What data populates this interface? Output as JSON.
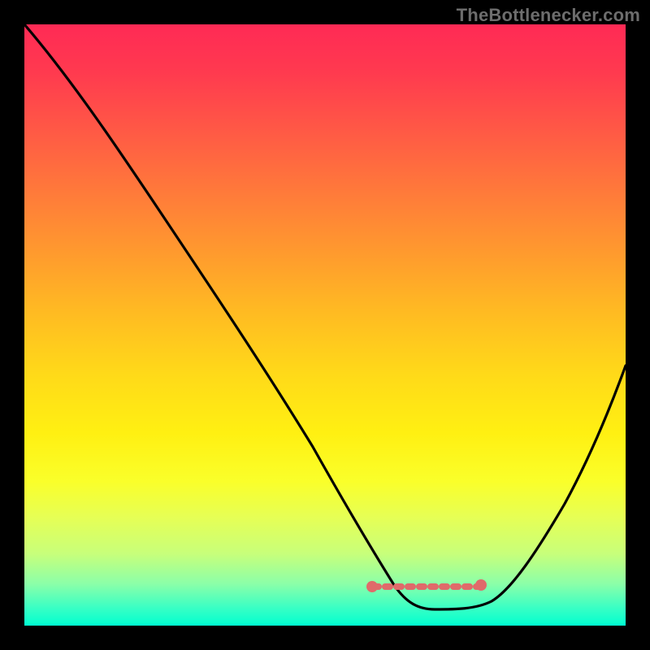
{
  "watermark": "TheBottleneсker.com",
  "chart_data": {
    "type": "line",
    "title": "",
    "xlabel": "",
    "ylabel": "",
    "xlim": [
      0,
      100
    ],
    "ylim": [
      0,
      100
    ],
    "series": [
      {
        "name": "bottleneck-curve",
        "x": [
          0,
          6,
          12,
          18,
          24,
          30,
          36,
          42,
          48,
          54,
          58,
          62,
          66,
          70,
          74,
          78,
          82,
          86,
          90,
          94,
          98,
          100
        ],
        "values": [
          100,
          91,
          82,
          73,
          64,
          55,
          46,
          37,
          28,
          19,
          13,
          8,
          5,
          3,
          3,
          4,
          8,
          15,
          24,
          34,
          44,
          49
        ]
      }
    ],
    "annotations": [
      {
        "name": "optimal-range-marker",
        "x_start": 58,
        "x_end": 76,
        "y": 6
      }
    ],
    "background_gradient": {
      "stops": [
        {
          "pos": 0.0,
          "color": "#ff2a55"
        },
        {
          "pos": 0.5,
          "color": "#ffd919"
        },
        {
          "pos": 0.8,
          "color": "#faff2a"
        },
        {
          "pos": 1.0,
          "color": "#00ffd0"
        }
      ]
    },
    "grid": false,
    "legend": false
  }
}
